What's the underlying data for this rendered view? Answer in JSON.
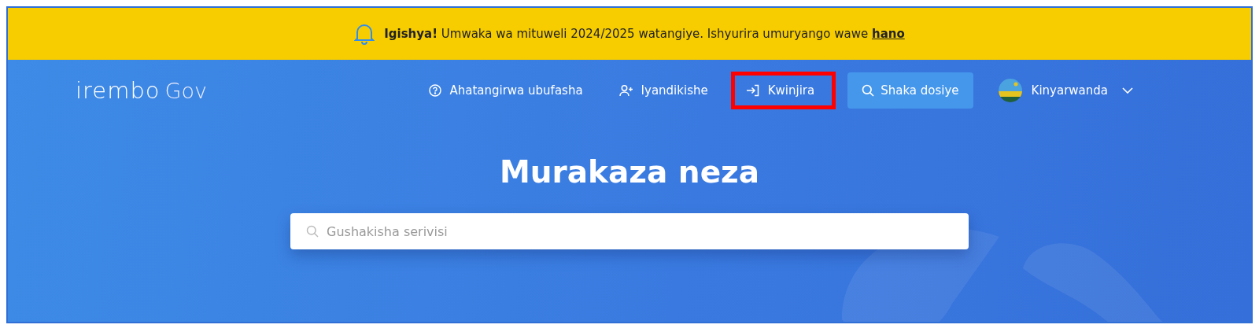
{
  "banner": {
    "message": "**Igishya!** Umwaka wa mituweli 2024/2025 watangiye. Ishyurira umuryango wawe",
    "link": "hano"
  },
  "logo": {
    "name": "irembo",
    "suffix": "Gov"
  },
  "nav": [
    {
      "kind": "help",
      "label": "Ahatangirwa ubufasha",
      "highlighted": false
    },
    {
      "kind": "register",
      "label": "Iyandikishe",
      "highlighted": false
    },
    {
      "kind": "login",
      "label": "Kwinjira",
      "highlighted": true
    },
    {
      "kind": "search",
      "label": "Shaka dosiye",
      "highlighted": false
    },
    {
      "kind": "language",
      "label": "Kinyarwanda",
      "highlighted": false
    }
  ],
  "hero": {
    "title": "Murakaza neza",
    "search": {
      "placeholder": "Gushakisha serivisi"
    }
  }
}
